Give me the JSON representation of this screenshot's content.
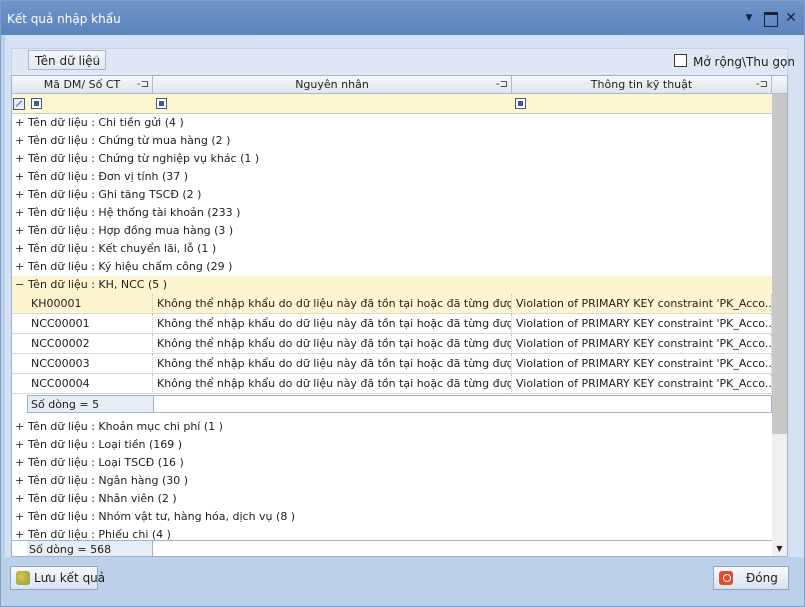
{
  "window": {
    "title": "Kết quả nhập khẩu"
  },
  "toolbar": {
    "group_chip": "Tên dữ liệu",
    "expand_label": "Mở rộng\\Thu gọn"
  },
  "columns": [
    "Mã DM/ Số CT",
    "Nguyên nhân",
    "Thông tin kỹ thuật"
  ],
  "groups_before": [
    "Tên dữ liệu : Chi tiền gửi (4 )",
    "Tên dữ liệu : Chứng từ mua hàng (2 )",
    "Tên dữ liệu : Chứng từ nghiệp vụ khác (1 )",
    "Tên dữ liệu : Đơn vị tính (37 )",
    "Tên dữ liệu : Ghi tăng TSCĐ (2 )",
    "Tên dữ liệu : Hệ thống tài khoản (233 )",
    "Tên dữ liệu : Hợp đồng mua hàng (3 )",
    "Tên dữ liệu : Kết chuyển lãi, lỗ (1 )",
    "Tên dữ liệu : Ký hiệu chấm công (29 )"
  ],
  "open_group": {
    "label": "Tên dữ liệu : KH, NCC (5 )",
    "rows": [
      {
        "code": "KH00001",
        "reason": "Không thể nhập khẩu do dữ liệu này đã tồn tại hoặc đã từng được nh...",
        "tech": "Violation of PRIMARY KEY constraint 'PK_Acco..."
      },
      {
        "code": "NCC00001",
        "reason": "Không thể nhập khẩu do dữ liệu này đã tồn tại hoặc đã từng được nh...",
        "tech": "Violation of PRIMARY KEY constraint 'PK_Acco..."
      },
      {
        "code": "NCC00002",
        "reason": "Không thể nhập khẩu do dữ liệu này đã tồn tại hoặc đã từng được nh...",
        "tech": "Violation of PRIMARY KEY constraint 'PK_Acco..."
      },
      {
        "code": "NCC00003",
        "reason": "Không thể nhập khẩu do dữ liệu này đã tồn tại hoặc đã từng được nh...",
        "tech": "Violation of PRIMARY KEY constraint 'PK_Acco..."
      },
      {
        "code": "NCC00004",
        "reason": "Không thể nhập khẩu do dữ liệu này đã tồn tại hoặc đã từng được nh...",
        "tech": "Violation of PRIMARY KEY constraint 'PK_Acco..."
      }
    ],
    "footer": "Số dòng = 5"
  },
  "groups_after": [
    "Tên dữ liệu : Khoản mục chi phí (1 )",
    "Tên dữ liệu : Loại tiền (169 )",
    "Tên dữ liệu : Loại TSCĐ (16 )",
    "Tên dữ liệu : Ngân hàng (30 )",
    "Tên dữ liệu : Nhân viên (2 )",
    "Tên dữ liệu : Nhóm vật tư, hàng hóa, dịch vụ (8 )",
    "Tên dữ liệu : Phiếu chi (4 )"
  ],
  "grid_footer": "Số dòng = 568",
  "buttons": {
    "save": "Lưu kết quả",
    "close": "Đóng"
  },
  "symbols": {
    "collapsed": "+",
    "expanded": "−"
  }
}
